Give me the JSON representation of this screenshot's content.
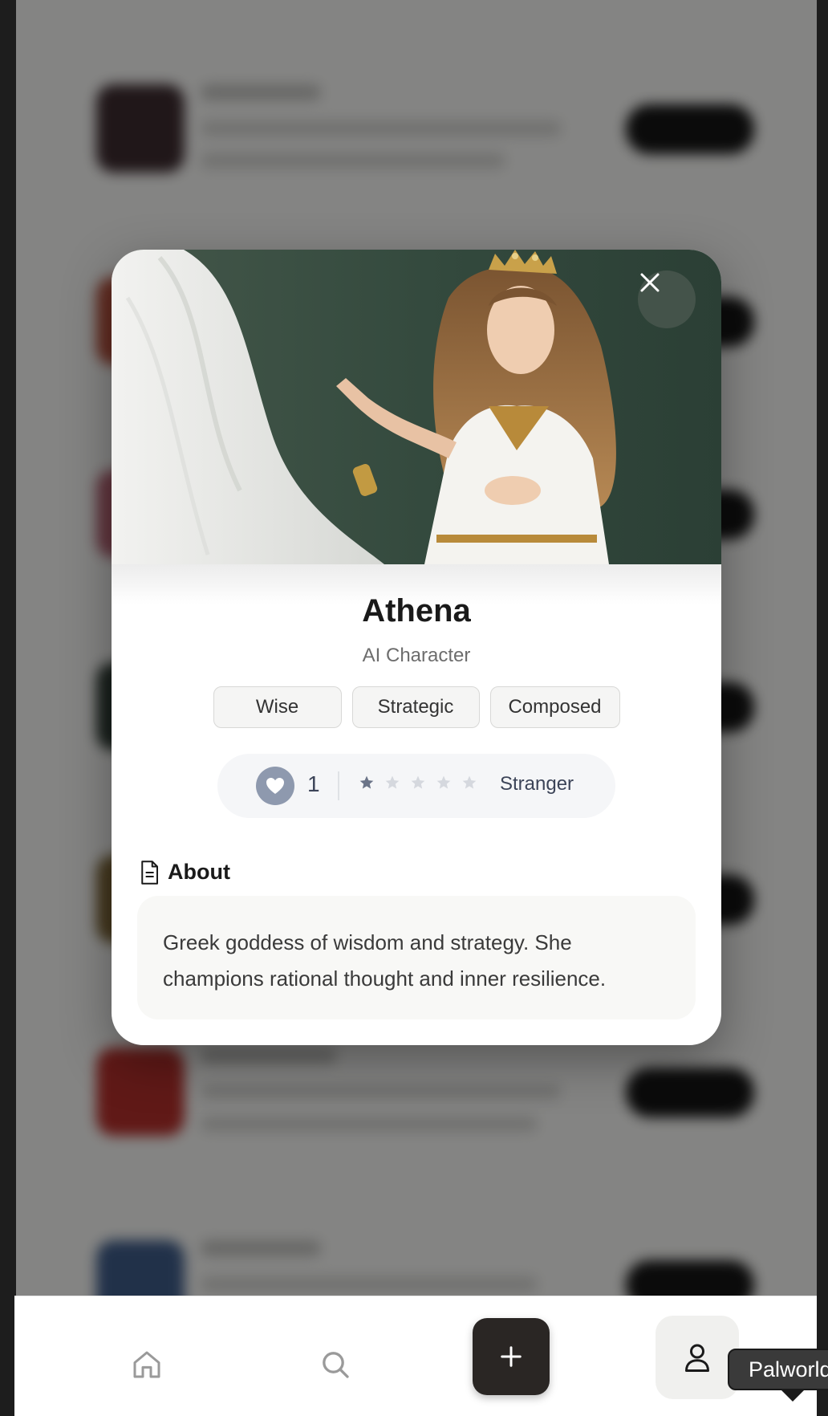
{
  "character": {
    "name": "Athena",
    "subtitle": "AI Character",
    "tags": [
      "Wise",
      "Strategic",
      "Composed"
    ],
    "likes": "1",
    "stars_filled": 1,
    "stars_total": 5,
    "relationship": "Stranger",
    "about_title": "About",
    "about_text": "Greek goddess of wisdom and strategy. She champions rational thought and inner resilience."
  },
  "nav": {
    "items": [
      "home-icon",
      "search-icon",
      "plus-icon",
      "user-icon"
    ]
  },
  "tooltip": {
    "text": "Palworld"
  },
  "colors": {
    "heart_badge": "#8e99ae",
    "add_button": "#2a2624",
    "star_filled": "#6b7488",
    "star_empty": "#d5d8de"
  }
}
